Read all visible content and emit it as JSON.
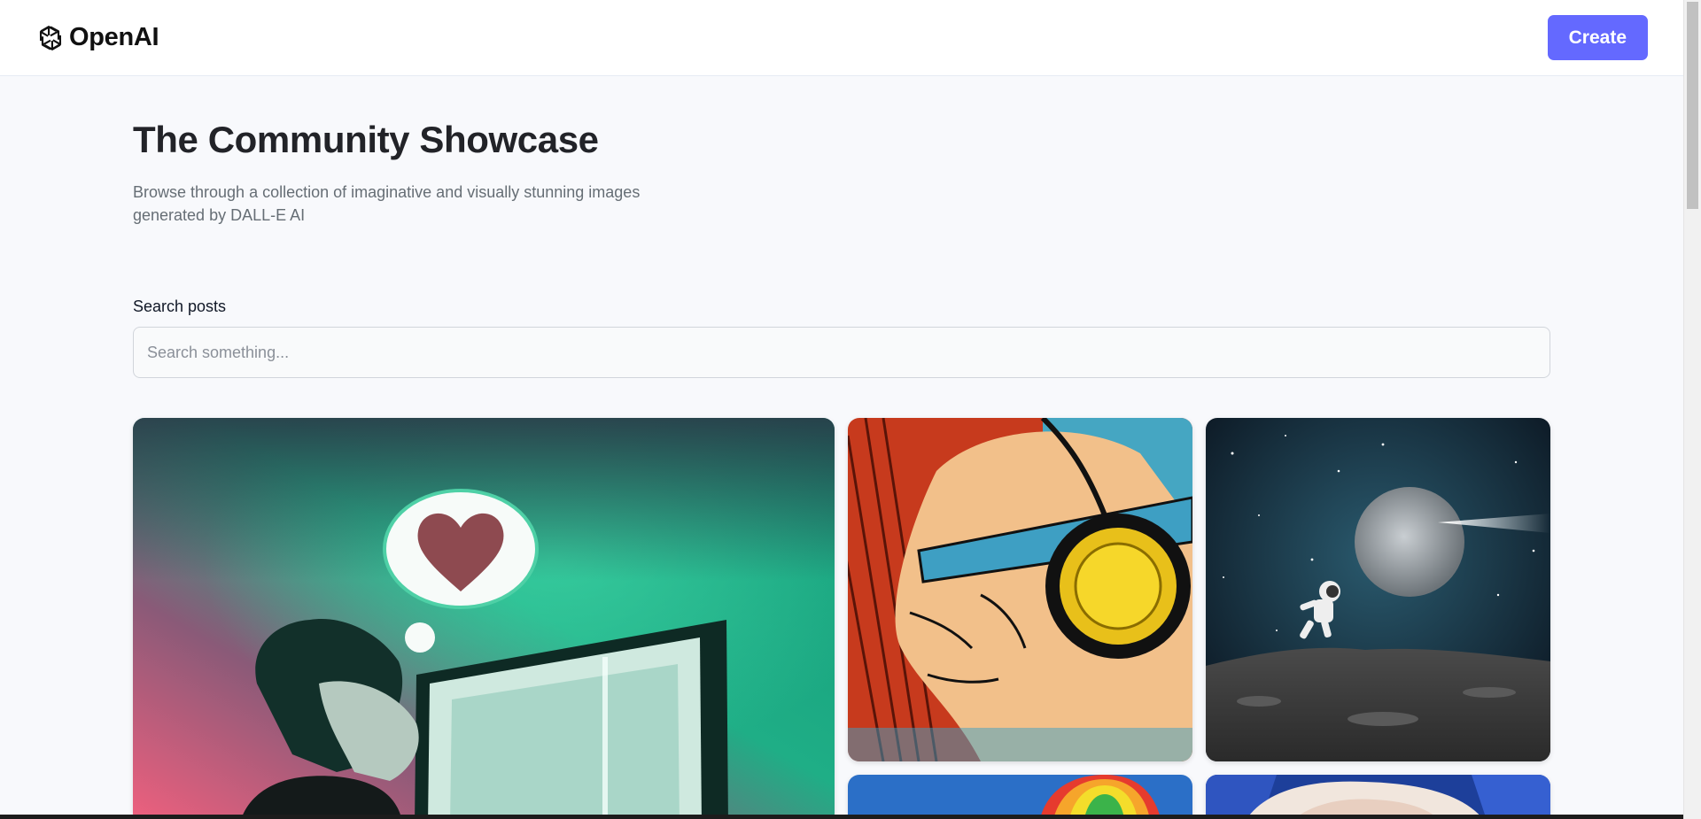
{
  "header": {
    "brand_name": "OpenAI",
    "create_label": "Create"
  },
  "main": {
    "title": "The Community Showcase",
    "subtitle": "Browse through a collection of imaginative and visually stunning images generated by DALL-E AI",
    "search_label": "Search posts",
    "search_placeholder": "Search something...",
    "search_value": ""
  },
  "gallery": {
    "cards": [
      {
        "subject": "person-thinking-of-heart-at-computer"
      },
      {
        "subject": "comic-hero-with-headphones"
      },
      {
        "subject": "astronaut-on-moon-with-comet"
      },
      {
        "subject": "rainbow-hot-air-balloon"
      },
      {
        "subject": "fluffy-animal-close-up"
      }
    ]
  },
  "colors": {
    "accent": "#6469ff",
    "page_bg": "#f8f9fc",
    "title": "#222328",
    "subtitle": "#666e75"
  }
}
